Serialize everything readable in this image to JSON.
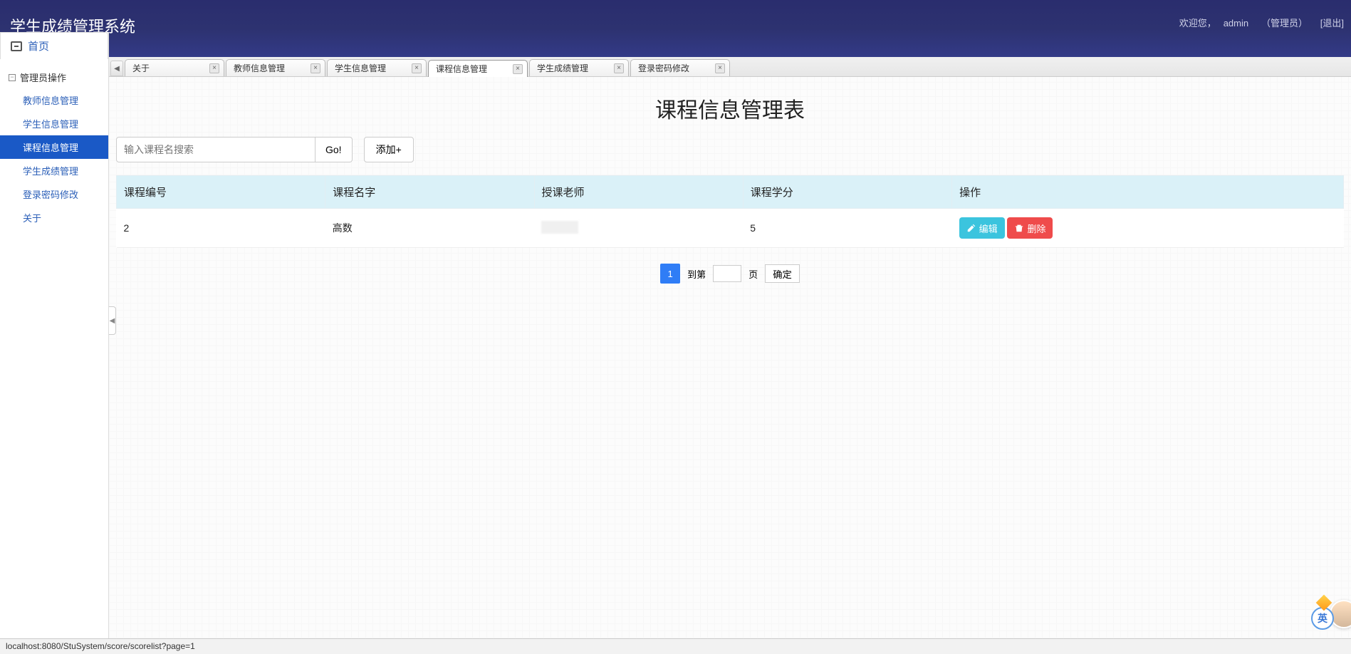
{
  "header": {
    "title": "学生成绩管理系统",
    "welcome_prefix": "欢迎您，",
    "username": "admin",
    "role": "（管理员）",
    "logout": "[退出]"
  },
  "home_tab": "首页",
  "sidebar": {
    "group_title": "管理员操作",
    "items": [
      {
        "label": "教师信息管理",
        "active": false
      },
      {
        "label": "学生信息管理",
        "active": false
      },
      {
        "label": "课程信息管理",
        "active": true
      },
      {
        "label": "学生成绩管理",
        "active": false
      },
      {
        "label": "登录密码修改",
        "active": false
      },
      {
        "label": "关于",
        "active": false
      }
    ]
  },
  "tabs": [
    {
      "label": "关于",
      "active": false
    },
    {
      "label": "教师信息管理",
      "active": false
    },
    {
      "label": "学生信息管理",
      "active": false
    },
    {
      "label": "课程信息管理",
      "active": true
    },
    {
      "label": "学生成绩管理",
      "active": false
    },
    {
      "label": "登录密码修改",
      "active": false
    }
  ],
  "page": {
    "title": "课程信息管理表",
    "search_placeholder": "输入课程名搜索",
    "search_btn": "Go!",
    "add_btn": "添加+"
  },
  "table": {
    "headers": [
      "课程编号",
      "课程名字",
      "授课老师",
      "课程学分",
      "操作"
    ],
    "rows": [
      {
        "id": "2",
        "name": "高数",
        "teacher": "",
        "credit": "5"
      }
    ],
    "edit_label": "编辑",
    "delete_label": "删除"
  },
  "pagination": {
    "current": "1",
    "goto_prefix": "到第",
    "goto_suffix": "页",
    "ok": "确定"
  },
  "status_bar": "localhost:8080/StuSystem/score/scorelist?page=1",
  "ime_label": "英"
}
